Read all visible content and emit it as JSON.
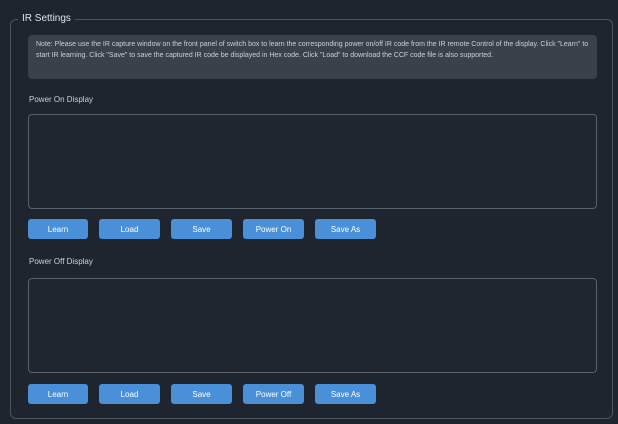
{
  "fieldset": {
    "legend": "IR Settings"
  },
  "note": {
    "text": "Note: Please use the IR capture window on the front panel of switch box to learn the corresponding power on/off IR code from the IR remote Control of the display. Click \"Learn\" to start IR learning. Click \"Save\" to save the captured IR code be displayed in Hex code. Click \"Load\" to download the CCF code file is also supported."
  },
  "power_on": {
    "label": "Power On Display",
    "value": "",
    "buttons": {
      "learn": "Learn",
      "load": "Load",
      "save": "Save",
      "power": "Power On",
      "save_as": "Save As"
    }
  },
  "power_off": {
    "label": "Power Off Display",
    "value": "",
    "buttons": {
      "learn": "Learn",
      "load": "Load",
      "save": "Save",
      "power": "Power Off",
      "save_as": "Save As"
    }
  },
  "colors": {
    "background": "#1e252e",
    "note_background": "#39414b",
    "button": "#4a90d9",
    "border": "#4a5561"
  }
}
